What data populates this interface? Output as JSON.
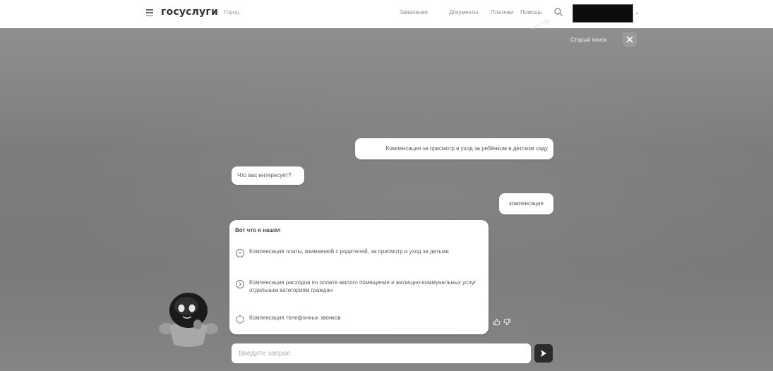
{
  "header": {
    "logo": "госуслуги",
    "city": "Город",
    "nav": [
      "Заявления",
      "Документы",
      "Платежи",
      "Помощь"
    ]
  },
  "search_panel": {
    "old_search_label": "Старый поиск"
  },
  "chat": {
    "messages": [
      {
        "from": "user",
        "text": "Компенсация за присмотр и уход за ребёнком в детском саду"
      },
      {
        "from": "bot",
        "text": "Что вас интересует?"
      },
      {
        "from": "user",
        "text": "компенсация"
      }
    ],
    "results_card": {
      "title": "Вот что я нашёл",
      "items": [
        "Компенсация платы, взимаемой с родителей, за присмотр и уход за детьми",
        "Компенсация расходов по оплате жилого помещения и жилищно-коммунальных услуг отдельным категориям граждан",
        "Компенсация телефонных звонков"
      ]
    }
  },
  "input": {
    "placeholder": "Введите запрос",
    "value": ""
  },
  "colors": {
    "overlay": "#808080",
    "send_button": "#2b2b2b",
    "profile_box": "#0d0d0d"
  },
  "icons": [
    "menu-icon",
    "search-icon",
    "close-icon",
    "item-icon",
    "like-icon",
    "dislike-icon",
    "send-icon"
  ]
}
